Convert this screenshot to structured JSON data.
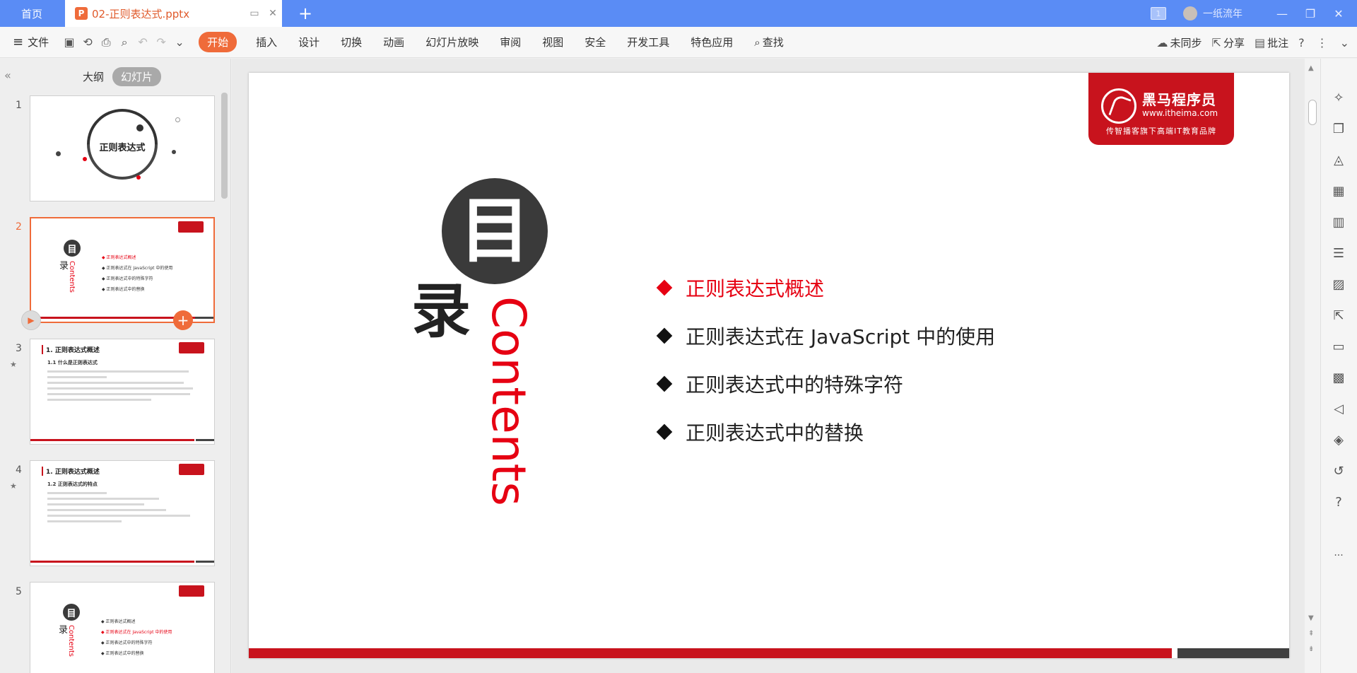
{
  "titlebar": {
    "home_tab": "首页",
    "doc_tab": "02-正则表达式.pptx",
    "window_count": "1",
    "user_name": "一纸流年"
  },
  "menubar": {
    "file": "文件",
    "start": "开始",
    "items": [
      "插入",
      "设计",
      "切换",
      "动画",
      "幻灯片放映",
      "审阅",
      "视图",
      "安全",
      "开发工具",
      "特色应用"
    ],
    "search": "查找",
    "sync": "未同步",
    "share": "分享",
    "comment": "批注"
  },
  "leftpanel": {
    "tab_outline": "大纲",
    "tab_slides": "幻灯片",
    "thumbs": [
      {
        "num": "1",
        "title": "正则表达式"
      },
      {
        "num": "2",
        "list": [
          "正则表达式概述",
          "正则表达式在 JavaScript 中的使用",
          "正则表达式中的特殊字符",
          "正则表达式中的替换"
        ]
      },
      {
        "num": "3",
        "heading": "1. 正则表达式概述",
        "sub": "1.1 什么是正则表达式"
      },
      {
        "num": "4",
        "heading": "1. 正则表达式概述",
        "sub": "1.2 正则表达式的特点"
      },
      {
        "num": "5",
        "list": [
          "正则表达式概述",
          "正则表达式在 JavaScript 中的使用",
          "正则表达式中的特殊字符",
          "正则表达式中的替换"
        ]
      }
    ]
  },
  "slide": {
    "logo_name": "黑马程序员",
    "logo_url": "www.itheima.com",
    "logo_tag": "传智播客旗下高端IT教育品牌",
    "mu": "目",
    "lu": "录",
    "contents": "Contents",
    "toc": [
      "正则表达式概述",
      "正则表达式在 JavaScript 中的使用",
      "正则表达式中的特殊字符",
      "正则表达式中的替换"
    ]
  },
  "colors": {
    "accent": "#ef6b3a",
    "brand_red": "#c8131d",
    "highlight_red": "#e60012",
    "titlebar": "#5a8cf5"
  }
}
